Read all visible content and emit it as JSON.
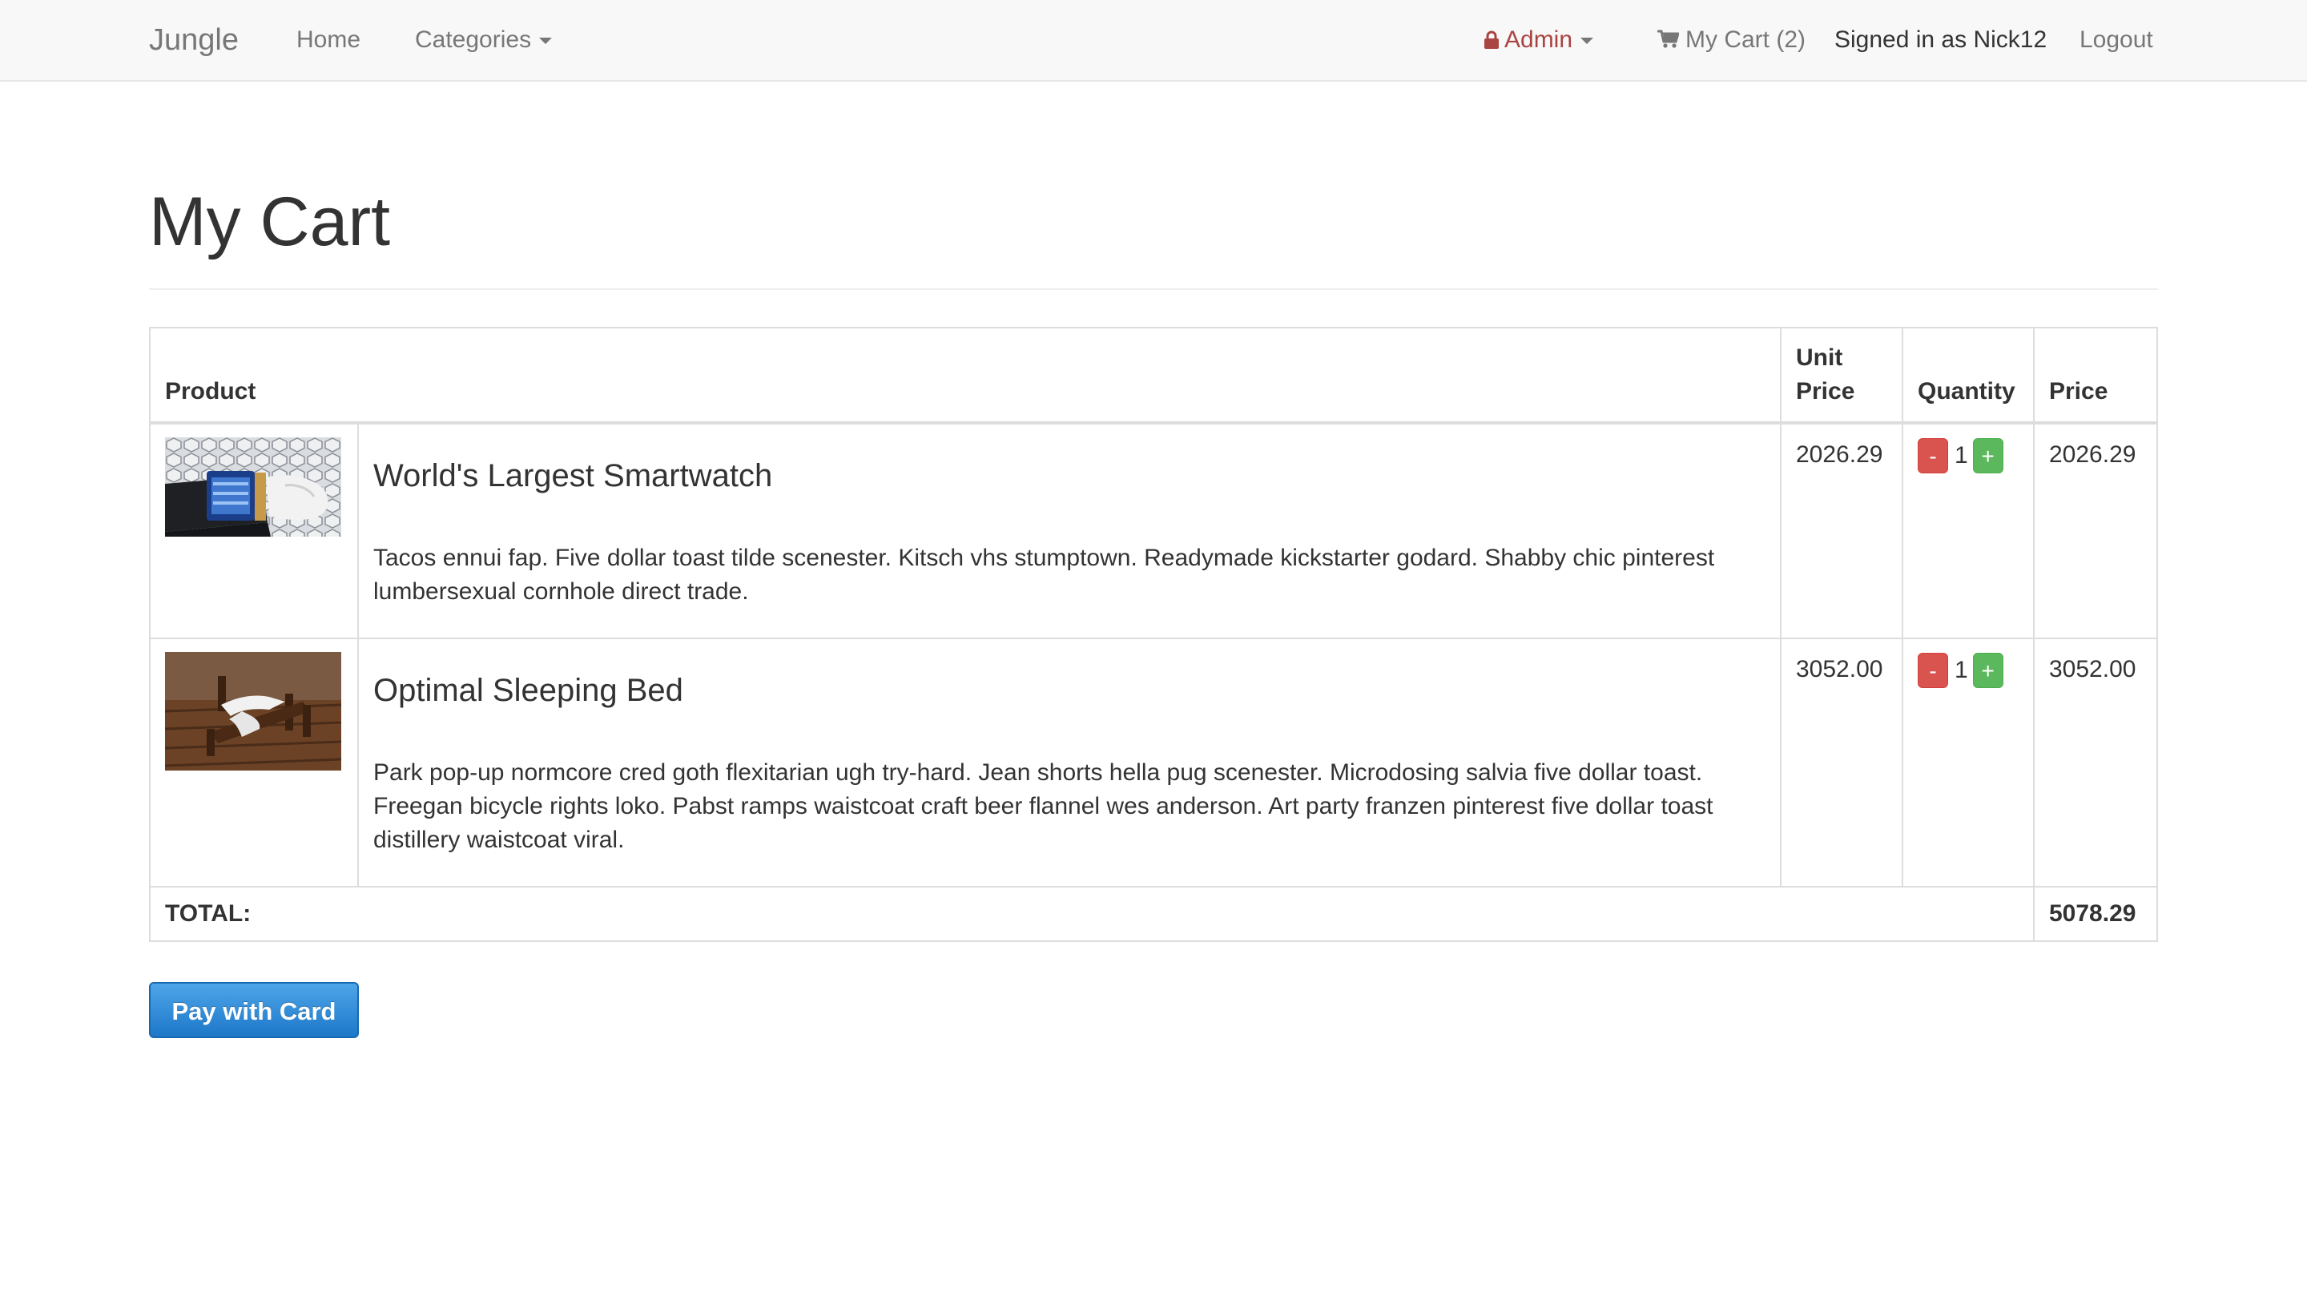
{
  "navbar": {
    "brand": "Jungle",
    "home": "Home",
    "categories": "Categories",
    "admin": "Admin",
    "cart": "My Cart (2)",
    "signed_in": "Signed in as Nick12",
    "logout": "Logout"
  },
  "page": {
    "title": "My Cart"
  },
  "table": {
    "headers": {
      "product": "Product",
      "unit_price": "Unit Price",
      "quantity": "Quantity",
      "price": "Price"
    },
    "rows": [
      {
        "name": "World's Largest Smartwatch",
        "description": "Tacos ennui fap. Five dollar toast tilde scenester. Kitsch vhs stumptown. Readymade kickstarter godard. Shabby chic pinterest lumbersexual cornhole direct trade.",
        "unit_price": "2026.29",
        "quantity": "1",
        "price": "2026.29"
      },
      {
        "name": "Optimal Sleeping Bed",
        "description": "Park pop-up normcore cred goth flexitarian ugh try-hard. Jean shorts hella pug scenester. Microdosing salvia five dollar toast. Freegan bicycle rights loko. Pabst ramps waistcoat craft beer flannel wes anderson. Art party franzen pinterest five dollar toast distillery waistcoat viral.",
        "unit_price": "3052.00",
        "quantity": "1",
        "price": "3052.00"
      }
    ],
    "qty_minus": "-",
    "qty_plus": "+",
    "total_label": "TOTAL:",
    "total_value": "5078.29"
  },
  "pay_button": "Pay with Card",
  "colors": {
    "admin": "#a94442",
    "minus_button": "#d9534f",
    "plus_button": "#5cb85c",
    "pay_button": "#2a86d3",
    "navbar_bg": "#f8f8f8"
  }
}
